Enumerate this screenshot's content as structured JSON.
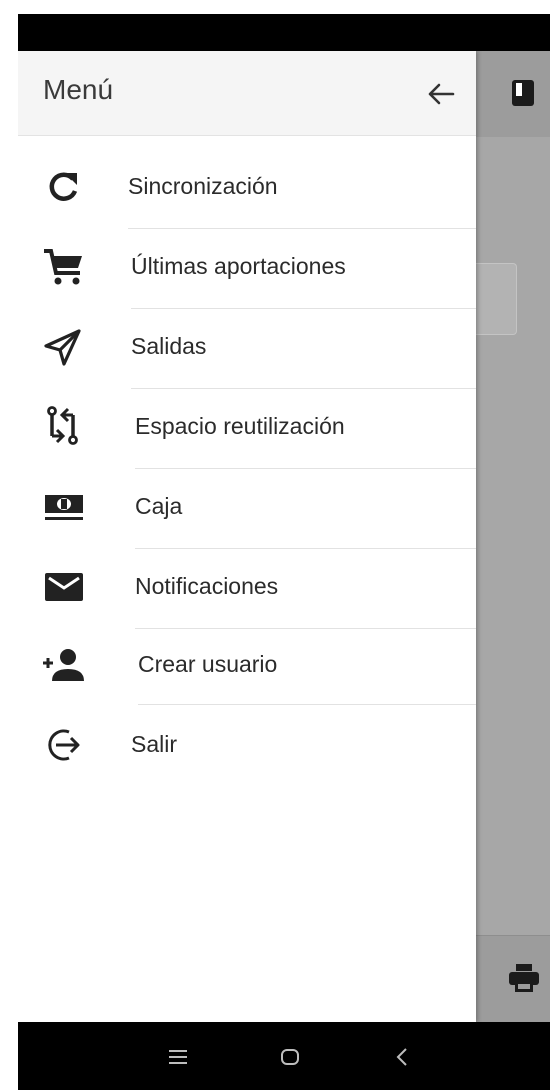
{
  "drawer": {
    "title": "Menú",
    "items": [
      {
        "label": "Sincronización",
        "icon": "sync-icon"
      },
      {
        "label": "Últimas aportaciones",
        "icon": "cart-icon"
      },
      {
        "label": "Salidas",
        "icon": "send-icon"
      },
      {
        "label": "Espacio reutilización",
        "icon": "swap-icon"
      },
      {
        "label": "Caja",
        "icon": "cash-icon"
      },
      {
        "label": "Notificaciones",
        "icon": "mail-icon"
      },
      {
        "label": "Crear usuario",
        "icon": "add-user-icon"
      },
      {
        "label": "Salir",
        "icon": "logout-icon"
      }
    ]
  },
  "colors": {
    "overlay": "#a7a7a7",
    "drawer_header": "#f5f5f5",
    "icon": "#222222"
  }
}
